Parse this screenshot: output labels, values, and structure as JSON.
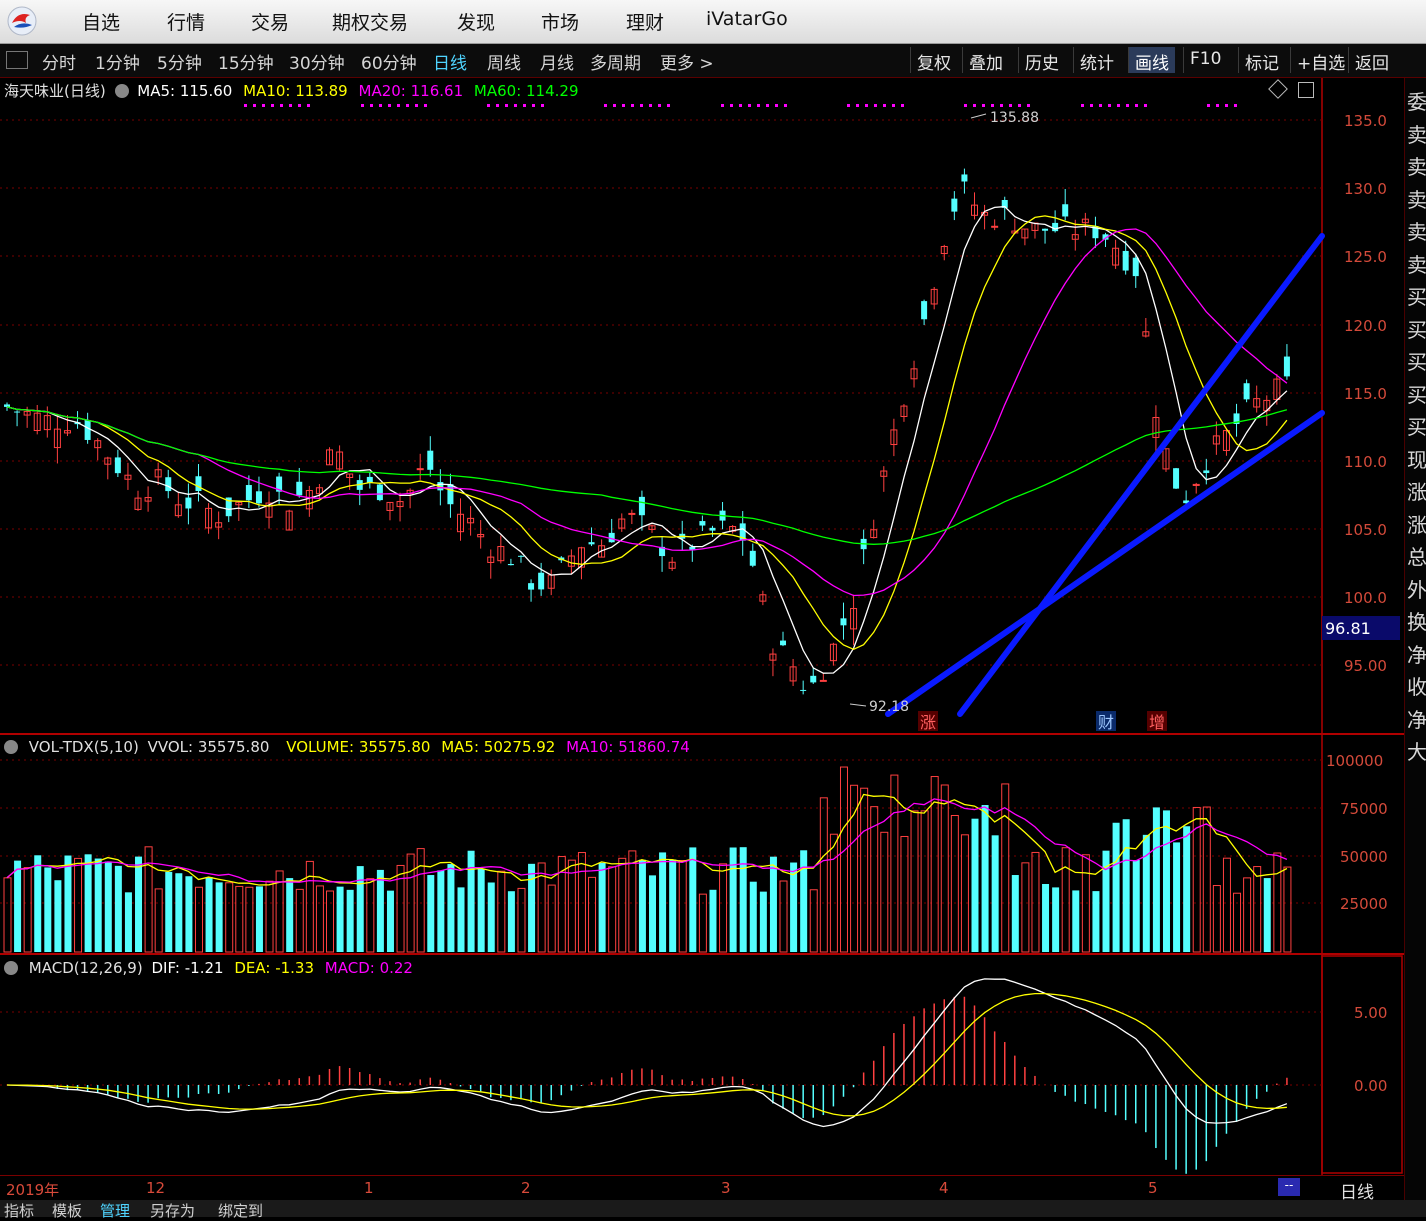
{
  "menu": {
    "items": [
      "自选",
      "行情",
      "交易",
      "期权交易",
      "发现",
      "市场",
      "理财",
      "iVatarGo"
    ]
  },
  "toolbar": {
    "periods": [
      "分时",
      "1分钟",
      "5分钟",
      "15分钟",
      "30分钟",
      "60分钟",
      "日线",
      "周线",
      "月线",
      "多周期",
      "更多 >"
    ],
    "active_period": "日线",
    "right_buttons": [
      "复权",
      "叠加",
      "历史",
      "统计",
      "画线",
      "F10",
      "标记",
      "+自选",
      "返回"
    ],
    "active_right": "画线"
  },
  "main_chart": {
    "stock": "海天味业(日线)",
    "ma5": "MA5: 115.60",
    "ma10": "MA10: 113.89",
    "ma20": "MA20: 116.61",
    "ma60": "MA60: 114.29",
    "price_labels": [
      "135.0",
      "130.0",
      "125.0",
      "120.0",
      "115.0",
      "110.0",
      "105.0",
      "100.0",
      "95.00"
    ],
    "current_price": "96.81",
    "high_label": "135.88",
    "low_label": "92.18",
    "markers": [
      "涨",
      "财",
      "增"
    ]
  },
  "vol_chart": {
    "name": "VOL-TDX(5,10)",
    "vvol": "VVOL: 35575.80",
    "volume": "VOLUME: 35575.80",
    "ma5": "MA5: 50275.92",
    "ma10": "MA10: 51860.74",
    "labels": [
      "100000",
      "75000",
      "50000",
      "25000"
    ]
  },
  "macd_chart": {
    "name": "MACD(12,26,9)",
    "dif": "DIF: -1.21",
    "dea": "DEA: -1.33",
    "macd": "MACD: 0.22",
    "labels": [
      "5.00",
      "0.00"
    ]
  },
  "dates": [
    "2019年",
    "12",
    "1",
    "2",
    "3",
    "4",
    "5"
  ],
  "bottom_tabs": [
    "指标",
    "模板",
    "管理",
    "另存为",
    "绑定到"
  ],
  "period_tag": "日线",
  "right_panel_chars": [
    "委",
    "卖",
    "卖",
    "卖",
    "卖",
    "卖",
    "买",
    "买",
    "买",
    "买",
    "买",
    "现",
    "涨",
    "涨",
    "总",
    "外",
    "换",
    "净",
    "收",
    "净",
    "大"
  ],
  "colors": {
    "up": "#ff4040",
    "down": "#54ffff",
    "ma5": "#ffffff",
    "ma10": "#ffff00",
    "ma20": "#ff00ff",
    "ma60": "#00ff00",
    "trendline": "#0a1aff"
  }
}
